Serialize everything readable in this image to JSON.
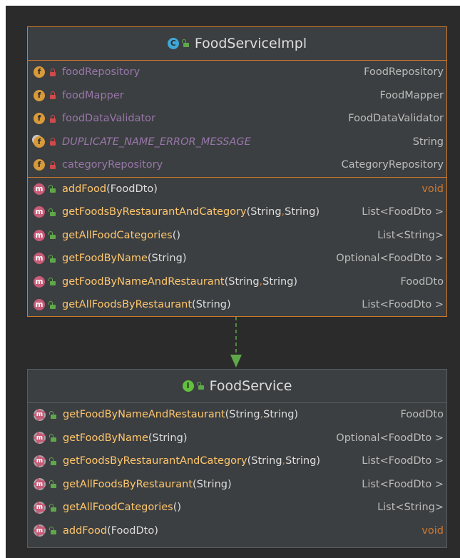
{
  "impl": {
    "badge": "C",
    "title": "FoodServiceImpl",
    "fields": [
      {
        "badge": "f",
        "name": "foodRepository",
        "type": "FoodRepository"
      },
      {
        "badge": "f",
        "name": "foodMapper",
        "type": "FoodMapper"
      },
      {
        "badge": "f",
        "name": "foodDataValidator",
        "type": "FoodDataValidator"
      },
      {
        "badge": "f",
        "name": "DUPLICATE_NAME_ERROR_MESSAGE",
        "type": "String"
      },
      {
        "badge": "f",
        "name": "categoryRepository",
        "type": "CategoryRepository"
      }
    ],
    "methods": [
      {
        "badge": "m",
        "name": "addFood",
        "params": "(FoodDto)",
        "type": "void"
      },
      {
        "badge": "m",
        "name": "getFoodsByRestaurantAndCategory",
        "p1": "(String",
        "comma": ",",
        "p2": " String)",
        "type": "List<FoodDto >"
      },
      {
        "badge": "m",
        "name": "getAllFoodCategories",
        "params": "()",
        "type": "List<String>"
      },
      {
        "badge": "m",
        "name": "getFoodByName",
        "params": "(String)",
        "type": "Optional<FoodDto >"
      },
      {
        "badge": "m",
        "name": "getFoodByNameAndRestaurant",
        "p1": "(String",
        "comma": ",",
        "p2": " String)",
        "type": "FoodDto"
      },
      {
        "badge": "m",
        "name": "getAllFoodsByRestaurant",
        "params": "(String)",
        "type": "List<FoodDto >"
      }
    ]
  },
  "iface": {
    "badge": "I",
    "title": "FoodService",
    "methods": [
      {
        "badge": "m",
        "name": "getFoodByNameAndRestaurant",
        "p1": "(String",
        "comma": ",",
        "p2": " String)",
        "type": "FoodDto"
      },
      {
        "badge": "m",
        "name": "getFoodByName",
        "params": "(String)",
        "type": "Optional<FoodDto >"
      },
      {
        "badge": "m",
        "name": "getFoodsByRestaurantAndCategory",
        "p1": "(String",
        "comma": ",",
        "p2": " String)",
        "type": "List<FoodDto >"
      },
      {
        "badge": "m",
        "name": "getAllFoodsByRestaurant",
        "params": "(String)",
        "type": "List<FoodDto >"
      },
      {
        "badge": "m",
        "name": "getAllFoodCategories",
        "params": "()",
        "type": "List<String>"
      },
      {
        "badge": "m",
        "name": "addFood",
        "params": "(FoodDto)",
        "type": "void"
      }
    ]
  },
  "colors": {
    "background": "#2b2b2b",
    "box": "#3c3f41",
    "accent_border": "#d07a2b",
    "arrow": "#5fa84a",
    "field": "#9876aa",
    "method": "#ffc66d",
    "keyword": "#cc7832"
  },
  "icons": {
    "class": "class-icon",
    "interface": "interface-icon",
    "field": "field-icon",
    "method": "method-icon",
    "private": "lock-icon",
    "public": "unlocked-icon"
  }
}
